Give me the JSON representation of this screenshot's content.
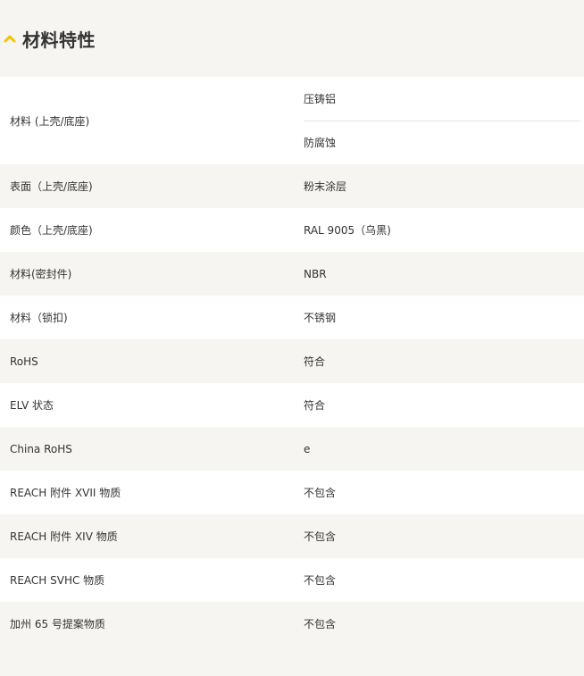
{
  "section": {
    "title": "材料特性",
    "icon": "chevron-up-icon",
    "accent_color": "#f5c400"
  },
  "rows": [
    {
      "label": "材料 (上壳/底座)",
      "values": [
        "压铸铝",
        "防腐蚀"
      ]
    },
    {
      "label": "表面（上壳/底座)",
      "values": [
        "粉末涂层"
      ]
    },
    {
      "label": "颜色（上壳/底座)",
      "values": [
        "RAL 9005（乌黑)"
      ]
    },
    {
      "label": "材料(密封件)",
      "values": [
        "NBR"
      ]
    },
    {
      "label": "材料（锁扣)",
      "values": [
        "不锈钢"
      ]
    },
    {
      "label": "RoHS",
      "values": [
        "符合"
      ]
    },
    {
      "label": "ELV 状态",
      "values": [
        "符合"
      ]
    },
    {
      "label": "China RoHS",
      "values": [
        "e"
      ]
    },
    {
      "label": "REACH 附件 XVII 物质",
      "values": [
        "不包含"
      ]
    },
    {
      "label": "REACH 附件 XIV 物质",
      "values": [
        "不包含"
      ]
    },
    {
      "label": "REACH SVHC 物质",
      "values": [
        "不包含"
      ]
    },
    {
      "label": "加州 65 号提案物质",
      "values": [
        "不包含"
      ]
    }
  ]
}
